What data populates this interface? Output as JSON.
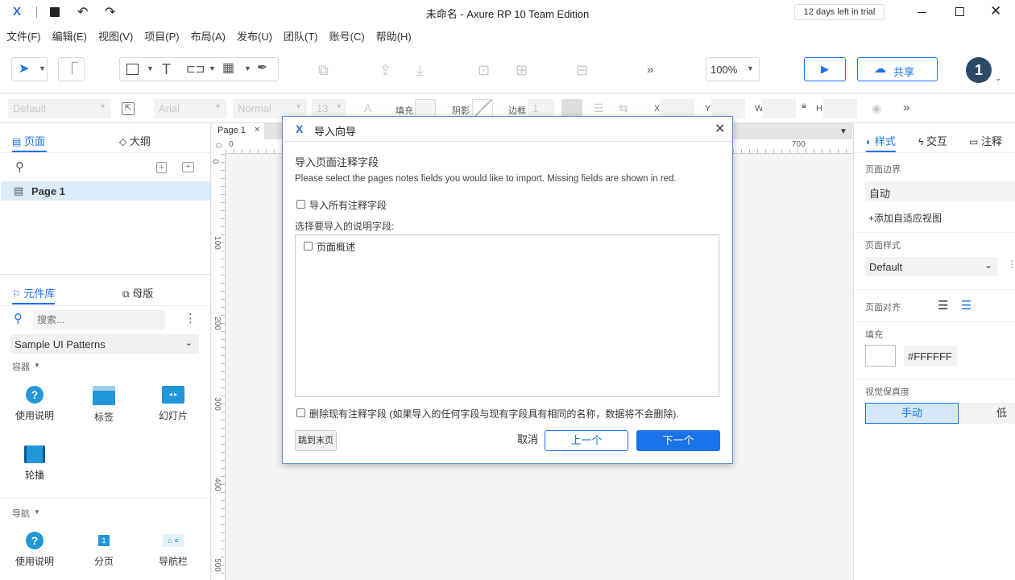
{
  "window": {
    "title": "未命名 - Axure RP 10 Team Edition",
    "trial": "12 days left in trial",
    "logo": "X"
  },
  "menu": [
    "文件(F)",
    "编辑(E)",
    "视图(V)",
    "项目(P)",
    "布局(A)",
    "发布(U)",
    "团队(T)",
    "账号(C)",
    "帮助(H)"
  ],
  "toolbar": {
    "zoom": "100%",
    "share": "共享",
    "avatar": "1"
  },
  "stylebar": {
    "style": "Default",
    "font": "Arial",
    "weight": "Normal",
    "size": "13",
    "fill": "填充",
    "shadow": "阴影",
    "border": "边框",
    "border_value": "1",
    "x": "X",
    "y": "Y",
    "w": "W",
    "h": "H"
  },
  "left": {
    "tab_pages": "页面",
    "tab_outline": "大纲",
    "page1": "Page 1",
    "tab_library": "元件库",
    "tab_masters": "母版",
    "search_placeholder": "搜索...",
    "library_select": "Sample UI Patterns",
    "section_container": "容器",
    "section_nav": "导航",
    "widgets1": [
      "使用说明",
      "标签",
      "幻灯片"
    ],
    "widget_carousel": "轮播",
    "widgets2": [
      "使用说明",
      "分页",
      "导航栏"
    ]
  },
  "canvas": {
    "tab": "Page 1",
    "hruler": [
      "0",
      "700"
    ],
    "vruler": [
      "0",
      "100",
      "200",
      "300",
      "400",
      "500"
    ]
  },
  "right": {
    "tab_style": "样式",
    "tab_interact": "交互",
    "tab_notes": "注释",
    "page_bound_label": "页面边界",
    "page_bound_value": "自动",
    "add_adaptive": "添加自适应视图",
    "page_style_label": "页面样式",
    "page_style_value": "Default",
    "page_align_label": "页面对齐",
    "fill_label": "填充",
    "fill_value": "#FFFFFF",
    "fidelity_label": "视觉保真度",
    "fidelity_manual": "手动",
    "fidelity_low": "低"
  },
  "dialog": {
    "title": "导入向导",
    "heading": "导入页面注释字段",
    "description": "Please select the pages notes fields you would like to import. Missing fields are shown in red.",
    "import_all": "导入所有注释字段",
    "select_label": "选择要导入的说明字段:",
    "field1": "页面概述",
    "delete_existing": "删除现有注释字段 (如果导入的任何字段与现有字段具有相同的名称，数据将不会删除).",
    "skip_to_end": "跳到末页",
    "cancel": "取消",
    "prev": "上一个",
    "next": "下一个"
  }
}
